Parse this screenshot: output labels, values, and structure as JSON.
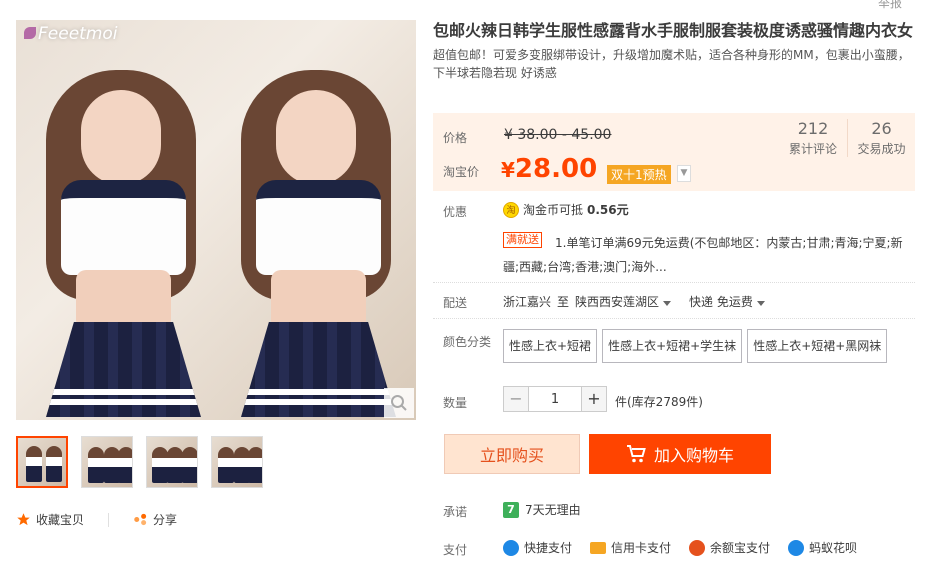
{
  "top": {
    "report": "举报"
  },
  "gallery": {
    "logo_text": "Feeetmoi",
    "zoom_icon": "magnifier-icon",
    "thumb_count": 4,
    "active_thumb": 1
  },
  "actions": {
    "favorite_label": "收藏宝贝",
    "favorite_icon": "star-icon",
    "share_label": "分享",
    "share_icon": "share-icon"
  },
  "product": {
    "title": "包邮火辣日韩学生服性感露背水手服制服套装极度诱惑骚情趣内衣女",
    "subtitle": "超值包邮！可爱多变服绑带设计，升级增加魔术贴，适合各种身形的MM，包裹出小蛮腰，下半球若隐若现 好诱惑"
  },
  "price": {
    "price_label": "价格",
    "original": "¥ 38.00 - 45.00",
    "taobao_label": "淘宝价",
    "currency": "¥",
    "current": "28.00",
    "promo_tag": "双十1预热",
    "accent_color": "#ff4400"
  },
  "stats": {
    "reviews_count": "212",
    "reviews_label": "累计评论",
    "deals_count": "26",
    "deals_label": "交易成功"
  },
  "promotion": {
    "label": "优惠",
    "coin_icon_text": "淘",
    "coin_text": "淘金币可抵",
    "coin_amount": "0.56元",
    "tag": "满就送",
    "detail": "1.单笔订单满69元免运费(不包邮地区：内蒙古;甘肃;青海;宁夏;新疆;西藏;台湾;香港;澳门;海外..."
  },
  "delivery": {
    "label": "配送",
    "from": "浙江嘉兴",
    "to_word": "至",
    "destination": "陕西西安莲湖区",
    "method": "快递 免运费"
  },
  "colors": {
    "label": "颜色分类",
    "options": [
      "性感上衣+短裙",
      "性感上衣+短裙+学生袜",
      "性感上衣+短裙+黑网袜"
    ]
  },
  "quantity": {
    "label": "数量",
    "value": "1",
    "minus": "−",
    "plus": "+",
    "stock": "件(库存2789件)"
  },
  "buttons": {
    "buy_now": "立即购买",
    "add_to_cart": "加入购物车",
    "cart_icon": "cart-icon"
  },
  "promise": {
    "label": "承诺",
    "icon_text": "7",
    "text": "7天无理由"
  },
  "payment": {
    "label": "支付",
    "methods": [
      {
        "name": "快捷支付",
        "icon": "quickpay-icon",
        "color": "#1e88e5"
      },
      {
        "name": "信用卡支付",
        "icon": "credit-card-icon",
        "color": "#f5a623"
      },
      {
        "name": "余额宝支付",
        "icon": "yuebao-icon",
        "color": "#e5511d"
      },
      {
        "name": "蚂蚁花呗",
        "icon": "huabei-icon",
        "color": "#1e88e5"
      }
    ]
  }
}
